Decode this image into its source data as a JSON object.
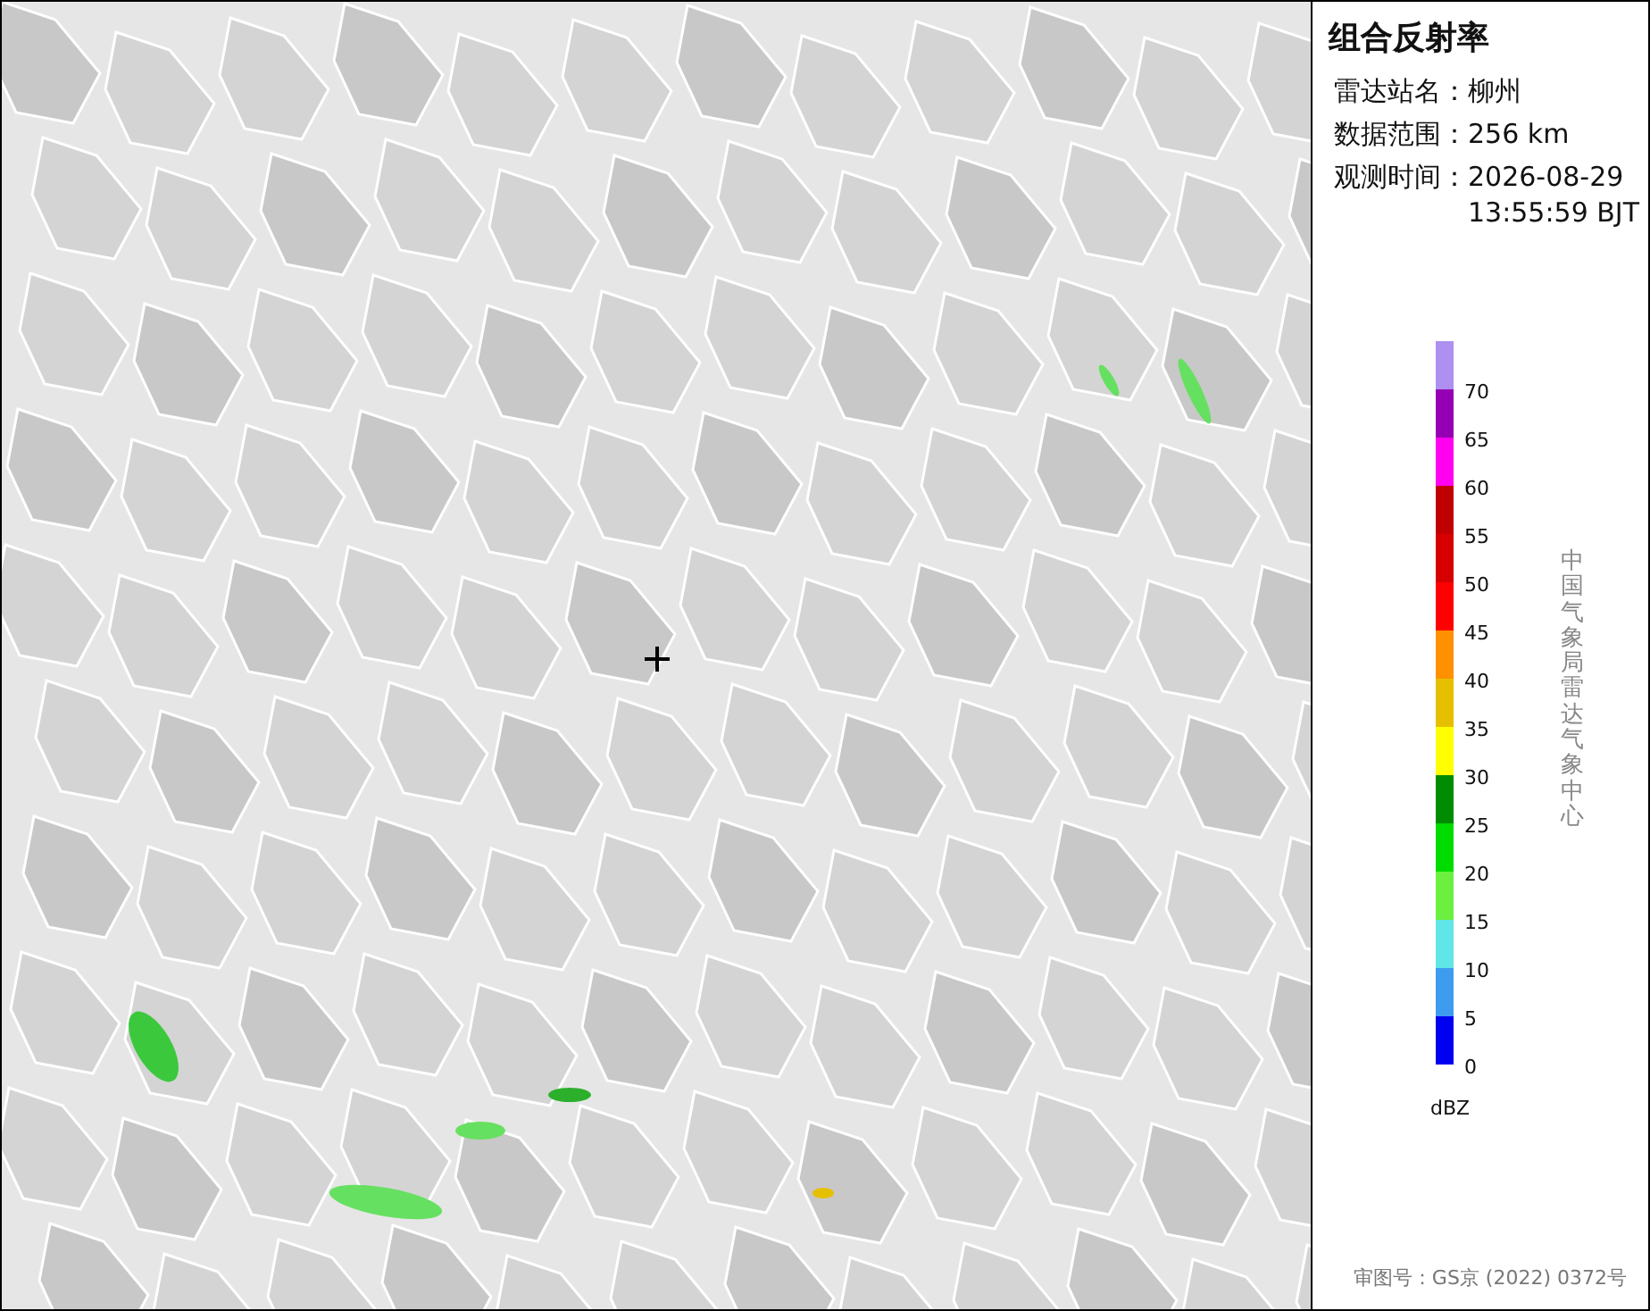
{
  "panel": {
    "title": "组合反射率",
    "info": [
      {
        "label": "雷达站名：",
        "value": "柳州"
      },
      {
        "label": "数据范围：",
        "value": "256 km"
      },
      {
        "label": "观测时间：",
        "value": "2026-08-29 13:55:59 BJT"
      }
    ],
    "legend": {
      "unit": "dBZ",
      "segments": [
        {
          "value": "70",
          "color": "#ad90f0"
        },
        {
          "value": "65",
          "color": "#9600b4"
        },
        {
          "value": "60",
          "color": "#ff00f0"
        },
        {
          "value": "55",
          "color": "#c00000"
        },
        {
          "value": "50",
          "color": "#d60000"
        },
        {
          "value": "45",
          "color": "#ff0000"
        },
        {
          "value": "40",
          "color": "#ff9000"
        },
        {
          "value": "35",
          "color": "#e6c000"
        },
        {
          "value": "30",
          "color": "#ffff00"
        },
        {
          "value": "25",
          "color": "#008c00"
        },
        {
          "value": "20",
          "color": "#00dc00"
        },
        {
          "value": "15",
          "color": "#6cf040"
        },
        {
          "value": "10",
          "color": "#60e6e6"
        },
        {
          "value": "5",
          "color": "#3d9cf0"
        },
        {
          "value": "0",
          "color": "#0000f0"
        }
      ]
    },
    "credit": "中国气象局雷达气象中心",
    "footer": "审图号：GS京 (2022) 0372号"
  }
}
